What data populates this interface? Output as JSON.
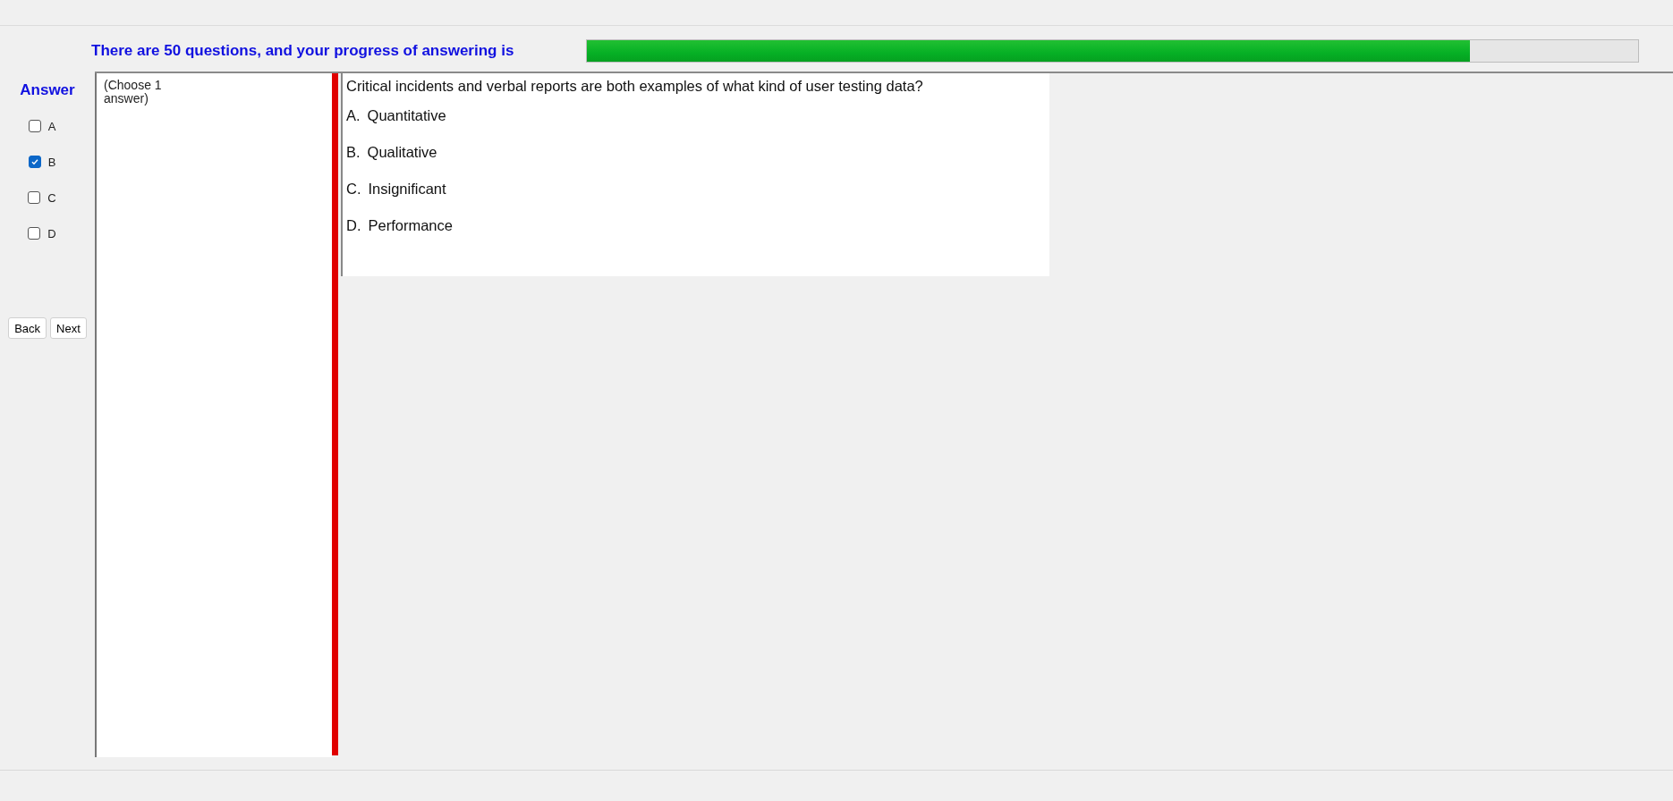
{
  "progress": {
    "label": "There are 50 questions, and your progress of answering is",
    "level": 0.84
  },
  "answer_panel": {
    "title": "Answer",
    "options": [
      {
        "label": "A",
        "checked": false
      },
      {
        "label": "B",
        "checked": true
      },
      {
        "label": "C",
        "checked": false
      },
      {
        "label": "D",
        "checked": false
      }
    ]
  },
  "buttons": [
    "Back",
    "Next"
  ],
  "instruction": "(Choose 1 answer)",
  "question": {
    "text": "Critical incidents and verbal reports are both examples of what kind of user testing data?",
    "choices": [
      {
        "letter": "A.",
        "text": "Quantitative"
      },
      {
        "letter": "B.",
        "text": "Qualitative"
      },
      {
        "letter": "C.",
        "text": "Insignificant"
      },
      {
        "letter": "D.",
        "text": "Performance"
      }
    ]
  }
}
